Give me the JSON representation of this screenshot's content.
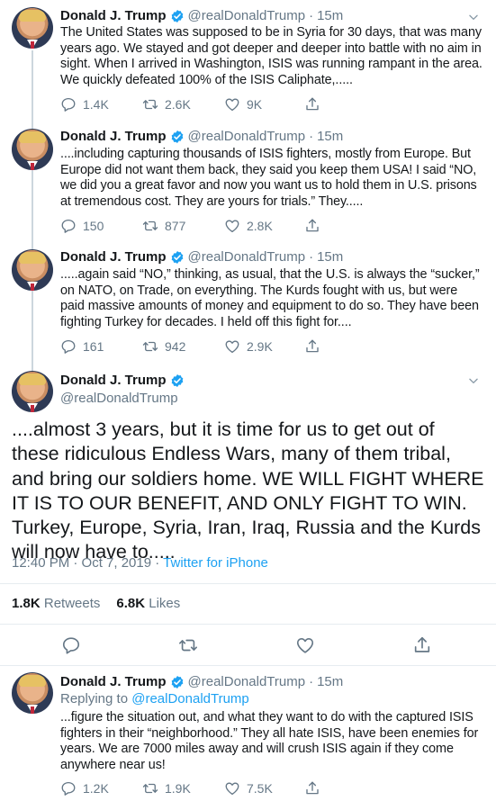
{
  "colors": {
    "accent": "#1da1f2",
    "muted": "#657786",
    "text": "#14171a",
    "divider": "#e6ecf0"
  },
  "author": {
    "name": "Donald J. Trump",
    "handle": "@realDonaldTrump",
    "verified_icon": "verified-badge-icon"
  },
  "tweets": [
    {
      "time": "15m",
      "text": "The United States was supposed to be in Syria for 30 days, that was many years ago. We stayed and got deeper and deeper into battle with no aim in sight. When I arrived in Washington, ISIS was running rampant in the area. We quickly defeated 100% of the ISIS Caliphate,.....",
      "replies": "1.4K",
      "retweets": "2.6K",
      "likes": "9K"
    },
    {
      "time": "15m",
      "text": "....including capturing thousands of ISIS fighters, mostly from Europe. But Europe did not want them back, they said you keep them USA! I said “NO, we did you a great favor and now you want us to hold them in U.S. prisons at tremendous cost. They are yours for trials.” They.....",
      "replies": "150",
      "retweets": "877",
      "likes": "2.8K"
    },
    {
      "time": "15m",
      "text": ".....again said “NO,” thinking, as usual, that the U.S. is always the “sucker,” on NATO, on Trade, on everything. The Kurds fought with us, but were paid massive amounts of money and equipment to do so. They have been fighting Turkey for decades. I held off this fight for....",
      "replies": "161",
      "retweets": "942",
      "likes": "2.9K"
    }
  ],
  "main_tweet": {
    "text": "....almost 3 years, but it is time for us to get out of these ridiculous Endless Wars, many of them tribal, and bring our soldiers home. WE WILL FIGHT WHERE IT IS TO OUR BENEFIT, AND ONLY FIGHT TO WIN. Turkey, Europe, Syria, Iran, Iraq, Russia and the Kurds will now have to.....",
    "timestamp": "12:40 PM · Oct 7, 2019",
    "separator": "·",
    "source": "Twitter for iPhone",
    "retweets_count": "1.8K",
    "retweets_label": "Retweets",
    "likes_count": "6.8K",
    "likes_label": "Likes"
  },
  "reply_tweet": {
    "time": "15m",
    "replying_label": "Replying to",
    "replying_handle": "@realDonaldTrump",
    "text": "...figure the situation out, and what they want to do with the captured ISIS fighters in their “neighborhood.” They all hate ISIS, have been enemies for years. We are 7000 miles away and will crush ISIS again if they come anywhere near us!",
    "replies": "1.2K",
    "retweets": "1.9K",
    "likes": "7.5K"
  }
}
